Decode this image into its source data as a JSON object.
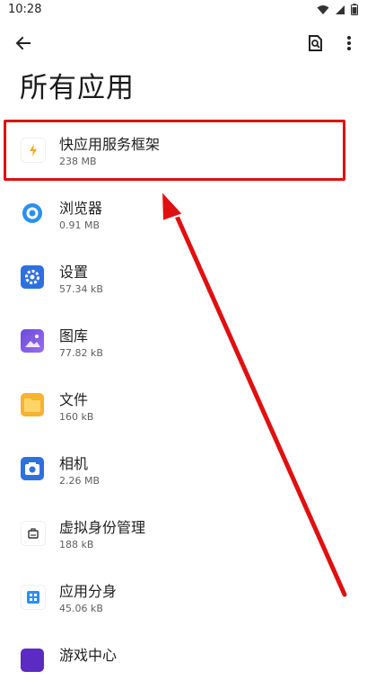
{
  "status_bar": {
    "time": "10:28"
  },
  "header": {
    "title": "所有应用"
  },
  "apps": [
    {
      "name": "快应用服务框架",
      "size": "238 MB",
      "icon": "quick-app-icon"
    },
    {
      "name": "浏览器",
      "size": "0.91 MB",
      "icon": "browser-icon"
    },
    {
      "name": "设置",
      "size": "57.34 kB",
      "icon": "settings-icon"
    },
    {
      "name": "图库",
      "size": "77.82 kB",
      "icon": "gallery-icon"
    },
    {
      "name": "文件",
      "size": "160 kB",
      "icon": "files-icon"
    },
    {
      "name": "相机",
      "size": "2.26 MB",
      "icon": "camera-icon"
    },
    {
      "name": "虚拟身份管理",
      "size": "188 kB",
      "icon": "virtual-identity-icon"
    },
    {
      "name": "应用分身",
      "size": "45.06 kB",
      "icon": "app-clone-icon"
    },
    {
      "name": "游戏中心",
      "size": "",
      "icon": "game-center-icon"
    }
  ],
  "colors": {
    "highlight": "#e01010",
    "arrow": "#e01010"
  }
}
